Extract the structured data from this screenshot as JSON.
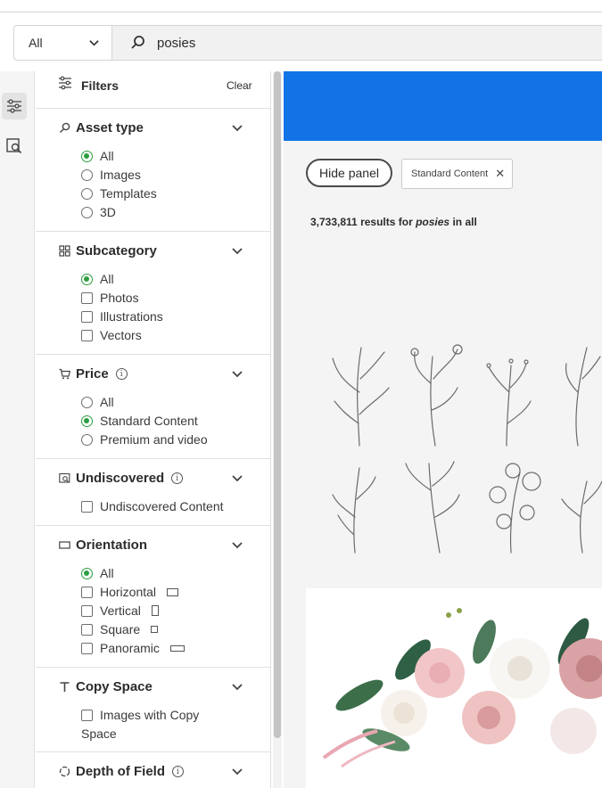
{
  "search": {
    "scope_label": "All",
    "query": "posies"
  },
  "filters": {
    "title": "Filters",
    "clear_label": "Clear",
    "asset_type": {
      "title": "Asset type",
      "options": [
        "All",
        "Images",
        "Templates",
        "3D"
      ],
      "selected": "All"
    },
    "subcategory": {
      "title": "Subcategory",
      "all_label": "All",
      "options": [
        "Photos",
        "Illustrations",
        "Vectors"
      ]
    },
    "price": {
      "title": "Price",
      "options": [
        "All",
        "Standard Content",
        "Premium and video"
      ],
      "selected": "Standard Content"
    },
    "undiscovered": {
      "title": "Undiscovered",
      "option": "Undiscovered Content"
    },
    "orientation": {
      "title": "Orientation",
      "all_label": "All",
      "options": [
        "Horizontal",
        "Vertical",
        "Square",
        "Panoramic"
      ]
    },
    "copy_space": {
      "title": "Copy Space",
      "option_line1": "Images with Copy",
      "option_line2": "Space"
    },
    "depth_of_field": {
      "title": "Depth of Field"
    }
  },
  "main": {
    "hide_panel_label": "Hide panel",
    "chip_label": "Standard Content",
    "results_count": "3,733,811",
    "results_mid": " results for ",
    "results_query": "posies",
    "results_suffix": " in all"
  },
  "colors": {
    "accent_green": "#2d9d3f",
    "banner_blue": "#1273e6"
  }
}
